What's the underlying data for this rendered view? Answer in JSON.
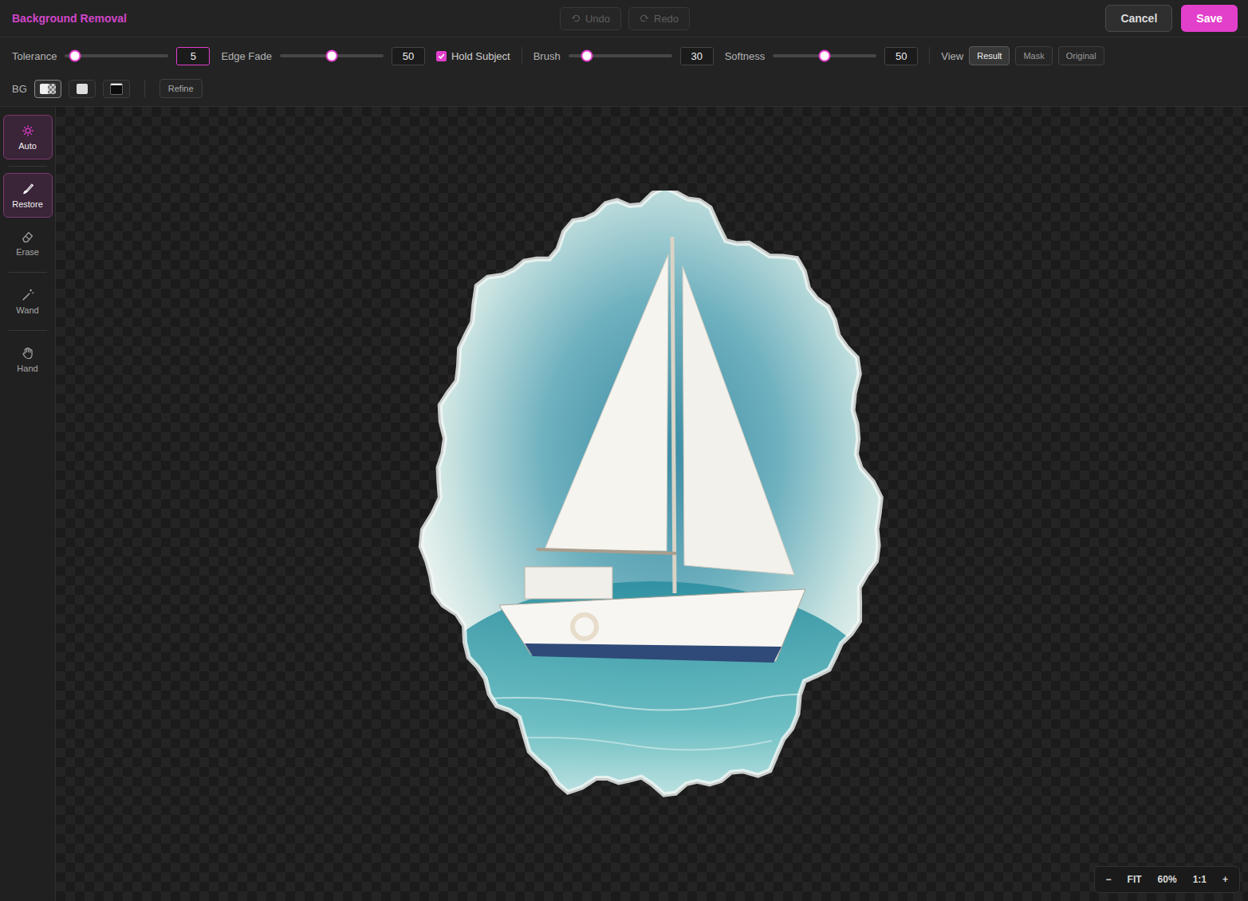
{
  "header": {
    "title": "Background Removal",
    "undo": {
      "label": "Undo",
      "disabled": true
    },
    "redo": {
      "label": "Redo",
      "disabled": true
    },
    "cancel": "Cancel",
    "save": "Save"
  },
  "toolbar": {
    "items": [
      {
        "kind": "slider",
        "label": "Tolerance",
        "value": "5",
        "level": 0.1,
        "focused": true
      },
      {
        "kind": "slider",
        "label": "Edge Fade",
        "value": "50",
        "level": 0.5,
        "focused": false
      },
      {
        "kind": "checkbox",
        "label": "Hold Subject",
        "checked": true
      },
      {
        "kind": "divider"
      },
      {
        "kind": "slider",
        "label": "Brush",
        "value": "30",
        "level": 0.18,
        "focused": false
      },
      {
        "kind": "slider",
        "label": "Softness",
        "value": "50",
        "level": 0.5,
        "focused": false
      },
      {
        "kind": "divider"
      },
      {
        "kind": "segmented",
        "label": "View",
        "options": [
          {
            "label": "Result",
            "selected": true
          },
          {
            "label": "Mask",
            "selected": false
          },
          {
            "label": "Original",
            "selected": false
          }
        ]
      }
    ]
  },
  "background": {
    "label": "BG",
    "swatches": [
      {
        "kind": "checker",
        "selected": true
      },
      {
        "kind": "light",
        "selected": false
      },
      {
        "kind": "dark",
        "selected": false
      }
    ],
    "refine": "Refine"
  },
  "tools": [
    {
      "kind": "tool",
      "label": "Auto",
      "selected": true
    },
    {
      "kind": "divider"
    },
    {
      "kind": "tool",
      "label": "Restore",
      "selected": true
    },
    {
      "kind": "tool",
      "label": "Erase",
      "selected": false
    },
    {
      "kind": "divider"
    },
    {
      "kind": "tool",
      "label": "Wand",
      "selected": false
    },
    {
      "kind": "divider"
    },
    {
      "kind": "tool",
      "label": "Hand",
      "selected": false
    }
  ],
  "zoom": {
    "buttons": [
      "−",
      "FIT",
      "60%",
      "1:1",
      "+"
    ]
  }
}
